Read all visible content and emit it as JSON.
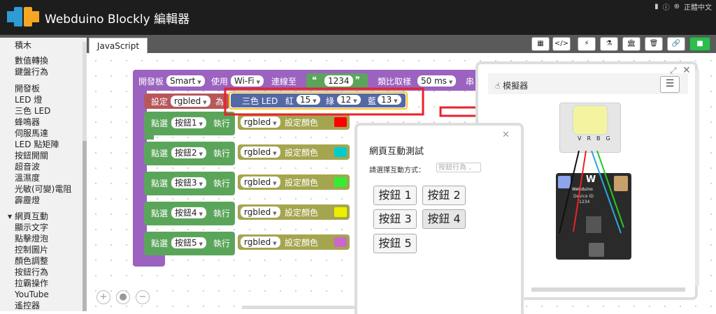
{
  "header": {
    "title": "Webduino Blockly 編輯器",
    "lang": "正體中文",
    "icons": [
      "book-icon",
      "info-icon",
      "globe-icon"
    ]
  },
  "sidebar": {
    "items": [
      "積木",
      "數值轉換",
      "鍵盤行為",
      "開發板",
      "LED 燈",
      "三色 LED",
      "蜂鳴器",
      "伺服馬達",
      "LED 點矩陣",
      "按鈕開關",
      "超音波",
      "溫濕度",
      "光敏(可變)電阻",
      "霹靂燈",
      "網頁互動",
      "顯示文字",
      "點擊燈泡",
      "控制圖片",
      "顏色調整",
      "按鈕行為",
      "拉霸操作",
      "YouTube",
      "遙控器"
    ]
  },
  "tab": {
    "label": "JavaScript"
  },
  "toolbar": {
    "buttons": [
      "qrcode-button",
      "code-button",
      "flash-button",
      "flask-button",
      "bank-button",
      "trash-button",
      "link-button",
      "run-button"
    ]
  },
  "blocks": {
    "board": {
      "label1": "開發板",
      "board": "Smart",
      "label2": "使用",
      "conn": "Wi-Fi",
      "label3": "連線至",
      "device_id": "1234",
      "label4": "類比取樣",
      "rate": "50 ms",
      "label5": "串"
    },
    "setvar": {
      "label1": "設定",
      "var": "rgbled",
      "label2": "為"
    },
    "rgb": {
      "label": "三色 LED",
      "red_label": "紅",
      "red": "15",
      "green_label": "綠",
      "green": "12",
      "blue_label": "藍",
      "blue": "13"
    },
    "clicks": [
      {
        "label1": "點選",
        "button": "按鈕1",
        "label2": "執行",
        "var": "rgbled",
        "action": "設定顏色",
        "color": "#ff0000"
      },
      {
        "label1": "點選",
        "button": "按鈕2",
        "label2": "執行",
        "var": "rgbled",
        "action": "設定顏色",
        "color": "#00cccc"
      },
      {
        "label1": "點選",
        "button": "按鈕3",
        "label2": "執行",
        "var": "rgbled",
        "action": "設定顏色",
        "color": "#33ee33"
      },
      {
        "label1": "點選",
        "button": "按鈕4",
        "label2": "執行",
        "var": "rgbled",
        "action": "設定顏色",
        "color": "#eeee00"
      },
      {
        "label1": "點選",
        "button": "按鈕5",
        "label2": "執行",
        "var": "rgbled",
        "action": "設定顏色",
        "color": "#cc66cc"
      }
    ]
  },
  "web_panel": {
    "title": "網頁互動測試",
    "select_label": "請選擇互動方式：",
    "select_value": "按鈕行為",
    "buttons": [
      "按鈕 1",
      "按鈕 2",
      "按鈕 3",
      "按鈕 4",
      "按鈕 5"
    ]
  },
  "simulator": {
    "title": "模擬器",
    "led_pins": [
      "V",
      "R",
      "B",
      "G"
    ],
    "board_brand": "Webduino",
    "device_label": "Device ID",
    "device_id": "1234"
  }
}
